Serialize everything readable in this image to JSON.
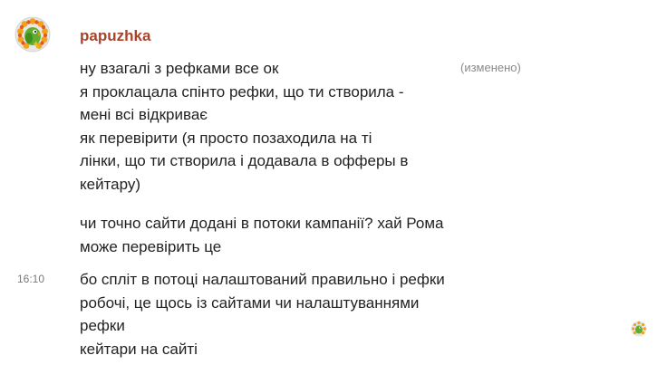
{
  "chat": {
    "author": "papuzhka",
    "edited_label": "(изменено)",
    "messages": [
      {
        "lines": [
          "ну взагалі з рефками все ок",
          "я проклацала спінто рефки, що ти створила -",
          "мені всі відкриває",
          "як перевірити (я просто позаходила на ті",
          "лінки, що ти створила і додавала в офферы в",
          "кейтару)"
        ],
        "edited": true
      },
      {
        "lines": [
          "чи точно сайти додані в потоки кампанії? хай Рома",
          "може перевірить це"
        ]
      },
      {
        "time": "16:10",
        "lines": [
          "бо спліт в потоці налаштований правильно і рефки",
          "робочі, це щось із сайтами чи налаштуваннями рефки",
          "кейтари на сайті"
        ]
      }
    ],
    "avatar_icon": "parrot-avatar-icon",
    "read_receipt_icon": "parrot-read-receipt-icon",
    "colors": {
      "author": "#a8432b",
      "text": "#222222",
      "meta": "#8a8a8a"
    }
  }
}
